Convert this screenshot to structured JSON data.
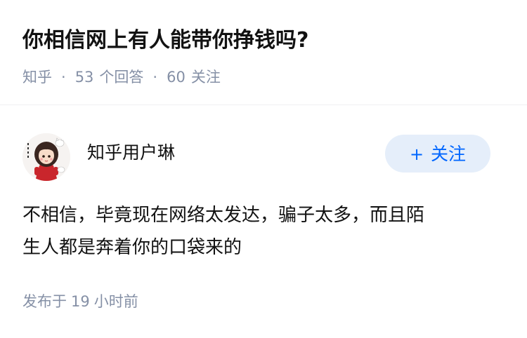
{
  "question": {
    "title": "你相信网上有人能带你挣钱吗?",
    "source": "知乎",
    "answer_count": "53",
    "answer_label": "个回答",
    "follower_count": "60",
    "follower_label": "关注",
    "separator": "·"
  },
  "answer": {
    "author_name": "知乎用户琳",
    "follow_button": {
      "icon": "+",
      "label": "关注"
    },
    "text_line1": "不相信，毕竟现在网络太发达，骗子太多，而且陌",
    "text_line2": "生人都是奔着你的口袋来的",
    "publish_prefix": "发布于",
    "publish_number": "19",
    "publish_unit": "小时前"
  },
  "colors": {
    "accent": "#0066ff",
    "follow_bg": "#e5eefa",
    "meta_text": "#8590a6",
    "body_text": "#121212"
  }
}
